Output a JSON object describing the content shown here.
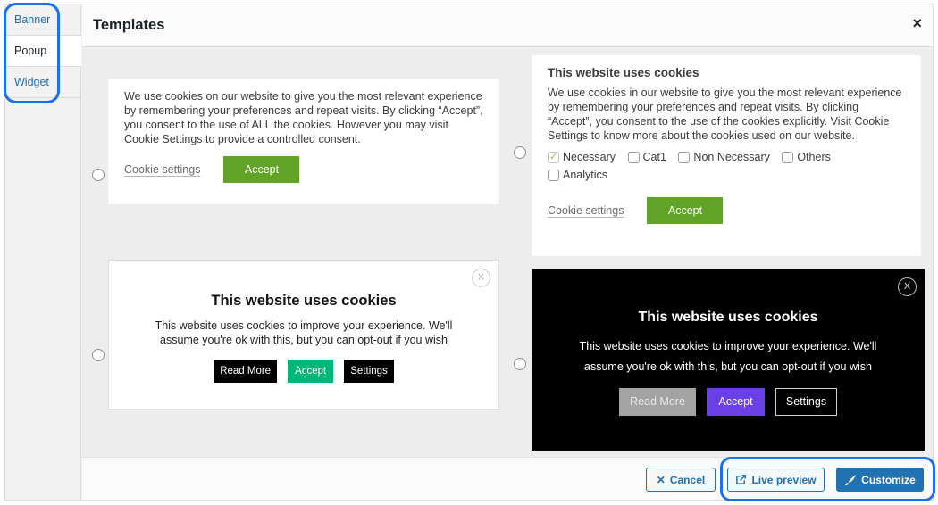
{
  "sidebar": {
    "items": [
      {
        "label": "Banner",
        "active": false
      },
      {
        "label": "Popup",
        "active": true
      },
      {
        "label": "Widget",
        "active": false
      }
    ]
  },
  "header": {
    "title": "Templates",
    "close_icon": "×"
  },
  "templates": {
    "t1": {
      "body": "We use cookies on our website to give you the most relevant experience by remembering your preferences and repeat visits. By clicking “Accept”, you consent to the use of ALL the cookies. However you may visit Cookie Settings to provide a controlled consent.",
      "settings_link": "Cookie settings",
      "accept_label": "Accept"
    },
    "t2": {
      "title": "This website uses cookies",
      "body": "We use cookies in our website to give you the most relevant experience by remembering your preferences and repeat visits. By clicking “Accept”, you consent to the use of the cookies explicitly. Visit Cookie Settings to know more about the cookies used on our website.",
      "categories": [
        {
          "label": "Necessary",
          "checked": true
        },
        {
          "label": "Cat1",
          "checked": false
        },
        {
          "label": "Non Necessary",
          "checked": false
        },
        {
          "label": "Others",
          "checked": false
        },
        {
          "label": "Analytics",
          "checked": false
        }
      ],
      "settings_link": "Cookie settings",
      "accept_label": "Accept"
    },
    "t3": {
      "close_label": "X",
      "title": "This website uses cookies",
      "body": "This website uses cookies to improve your experience. We'll assume you're ok with this, but you can opt-out if you wish",
      "read_more_label": "Read More",
      "accept_label": "Accept",
      "settings_label": "Settings"
    },
    "t4": {
      "close_label": "X",
      "title": "This website uses cookies",
      "body": "This website uses cookies to improve your experience. We'll assume you're ok with this, but you can opt-out if you wish",
      "read_more_label": "Read More",
      "accept_label": "Accept",
      "settings_label": "Settings"
    }
  },
  "footer": {
    "cancel_icon": "✕",
    "cancel_label": "Cancel",
    "preview_icon": "external-link",
    "preview_label": "Live preview",
    "customize_icon": "brush",
    "customize_label": "Customize"
  },
  "colors": {
    "accent_blue": "#2271b1",
    "highlight_blue": "#1c6ff0",
    "accept_green": "#61a229",
    "accept_teal": "#00b77b",
    "accept_purple": "#6a40e6"
  }
}
